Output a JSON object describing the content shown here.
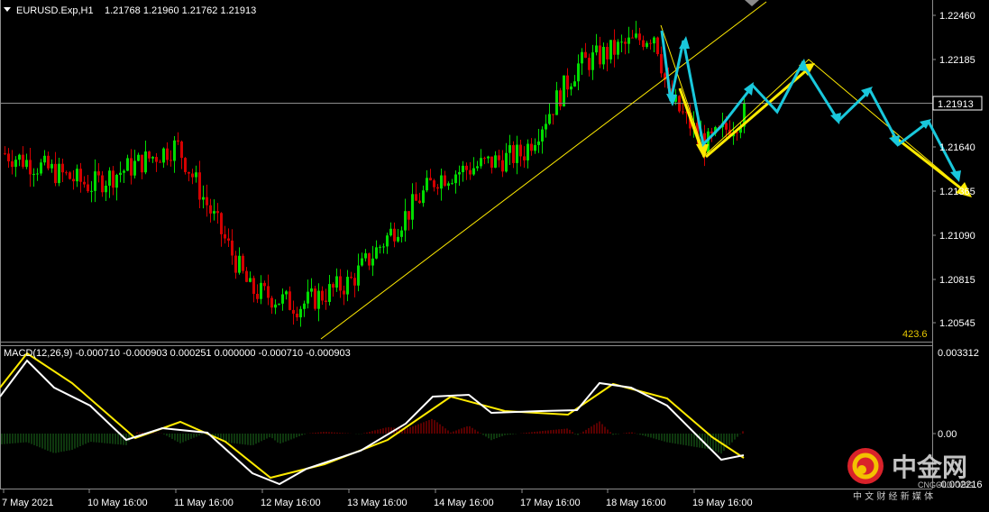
{
  "header": {
    "symbol": "EURUSD.Exp,H1",
    "ohlc": "1.21768 1.21960 1.21762 1.21913"
  },
  "price_axis": {
    "ticks": [
      "1.22460",
      "1.22185",
      "1.21640",
      "1.21365",
      "1.21090",
      "1.20815",
      "1.20545"
    ],
    "current_price_label": "1.21913",
    "bottom_value_label": "423.6"
  },
  "macd_panel": {
    "label": "MACD(12,26,9) -0.000710 -0.000903 0.000251 0.000000 -0.000710 -0.000903",
    "ticks": [
      "0.003312",
      "0.00",
      "-0.002216"
    ]
  },
  "time_axis": {
    "ticks": [
      "7 May 2021",
      "10 May 16:00",
      "11 May 16:00",
      "12 May 16:00",
      "13 May 16:00",
      "14 May 16:00",
      "17 May 16:00",
      "18 May 16:00",
      "19 May 16:00"
    ]
  },
  "watermark": {
    "cn_name": "中金网",
    "domain": "CNGOLD.ORG",
    "tagline": "中 文 财 经 新 媒 体"
  },
  "colors": {
    "bull": "#00dc00",
    "bear": "#d40000",
    "yellow": "#ffeb00",
    "cyan": "#19c8dc",
    "grid": "#8c8c8c",
    "macd_pos": "#b00000",
    "macd_neg": "#1c6e1c"
  },
  "chart_data": [
    {
      "type": "candlestick",
      "series_name": "EURUSD.Exp,H1",
      "ylim": [
        1.2045,
        1.2255
      ],
      "key_points": [
        {
          "time": "7 May 2021",
          "close": 1.216
        },
        {
          "time": "10 May 16:00",
          "close": 1.214
        },
        {
          "time": "11 May 16:00",
          "close": 1.2165
        },
        {
          "time": "12 May 16:00",
          "close": 1.2075
        },
        {
          "time": "12 May 20:00",
          "close": 1.2065
        },
        {
          "time": "13 May 16:00",
          "close": 1.208
        },
        {
          "time": "14 May 16:00",
          "close": 1.2145
        },
        {
          "time": "17 May 16:00",
          "close": 1.216
        },
        {
          "time": "18 May 04:00",
          "close": 1.2215
        },
        {
          "time": "18 May 16:00",
          "close": 1.2235
        },
        {
          "time": "19 May 04:00",
          "close": 1.2195
        },
        {
          "time": "19 May 10:00",
          "close": 1.2165
        },
        {
          "time": "19 May 16:00",
          "close": 1.2185
        }
      ],
      "current_price": 1.21913
    },
    {
      "type": "line",
      "series_name": "MACD(12,26,9)",
      "values": {
        "main": -0.00071,
        "signal": -0.000903,
        "histogram": 0.000251
      },
      "ylim": [
        -0.002216,
        0.003312
      ]
    }
  ]
}
